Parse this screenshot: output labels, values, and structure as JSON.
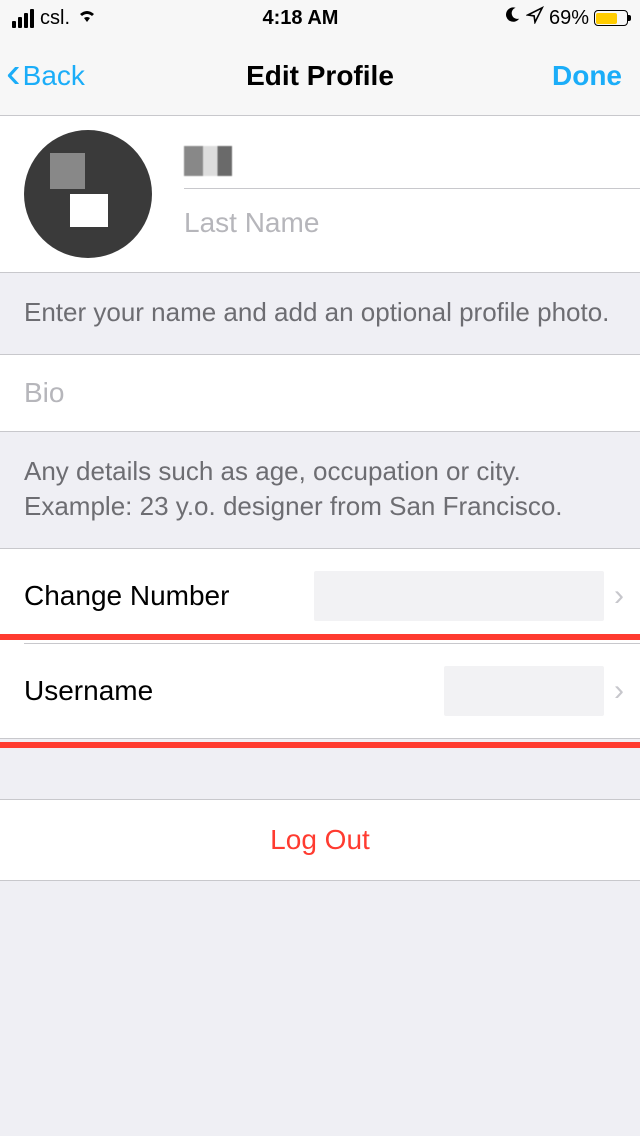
{
  "status": {
    "carrier": "csl.",
    "time": "4:18 AM",
    "battery_pct": "69%",
    "battery_fill_pct": 69
  },
  "nav": {
    "back_label": "Back",
    "title": "Edit Profile",
    "done_label": "Done"
  },
  "profile": {
    "first_name_value": "",
    "last_name_placeholder": "Last Name",
    "last_name_value": ""
  },
  "hints": {
    "name_hint": "Enter your name and add an optional profile photo.",
    "bio_hint": "Any details such as age, occupation or city. Example: 23 y.o. designer from San Francisco."
  },
  "bio": {
    "placeholder": "Bio",
    "value": ""
  },
  "rows": {
    "change_number_label": "Change Number",
    "username_label": "Username"
  },
  "logout": {
    "label": "Log Out"
  },
  "colors": {
    "accent": "#1badf8",
    "destructive": "#ff3b30",
    "battery_fill": "#ffcc00"
  },
  "highlight": {
    "target": "username-row"
  }
}
